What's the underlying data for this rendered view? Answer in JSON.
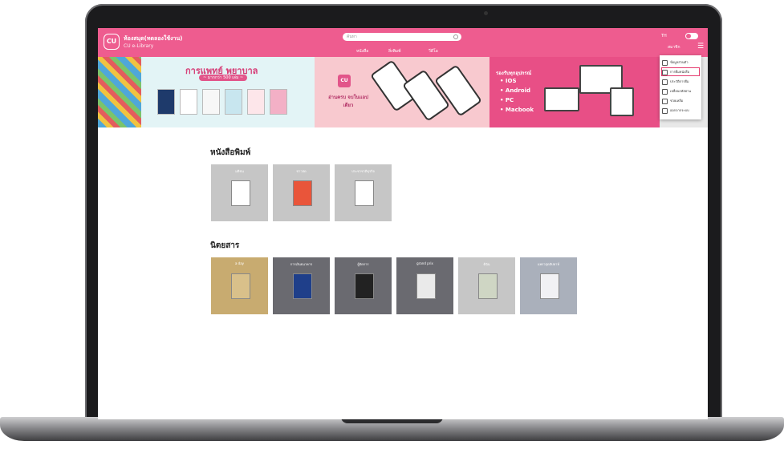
{
  "header": {
    "logo_text": "CU",
    "title": "ห้องสมุด(ทดลองใช้งาน)",
    "subtitle": "CU e-Library",
    "search_placeholder": "ค้นหา",
    "nav": [
      "หนังสือ",
      "สิ่งพิมพ์",
      "วีดีโอ"
    ],
    "lang": "TH",
    "user": "สมาชิก"
  },
  "menu": {
    "items": [
      "ข้อมูลส่วนตัว",
      "การยืมหนังสือ",
      "ประวัติการยืม",
      "เปลี่ยนรหัสผ่าน",
      "ช่วยเหลือ",
      "ออกจากระบบ"
    ],
    "active_index": 1
  },
  "banner": {
    "medical_title": "การแพทย์ พยาบาล",
    "medical_sub": "~ มากกว่า 500 เล่ม ~",
    "read_logo": "CU",
    "read_text": "อ่านครบ จบในแอปเดียว",
    "devices_head": "รองรับทุกอุปกรณ์",
    "devices": [
      "IOS",
      "Android",
      "PC",
      "Macbook"
    ]
  },
  "sections": {
    "printed_title": "หนังสือพิมพ์",
    "printed": [
      "มติชน",
      "ข่าวสด",
      "ประชาชาติธุรกิจ"
    ],
    "magazines_title": "นิตยสาร",
    "magazines": [
      "a day",
      "การเงินธนาคาร",
      "ผู้จัดการ",
      "grand prix",
      "ดิฉัน",
      "แพรวสุดสัปดาห์"
    ]
  }
}
